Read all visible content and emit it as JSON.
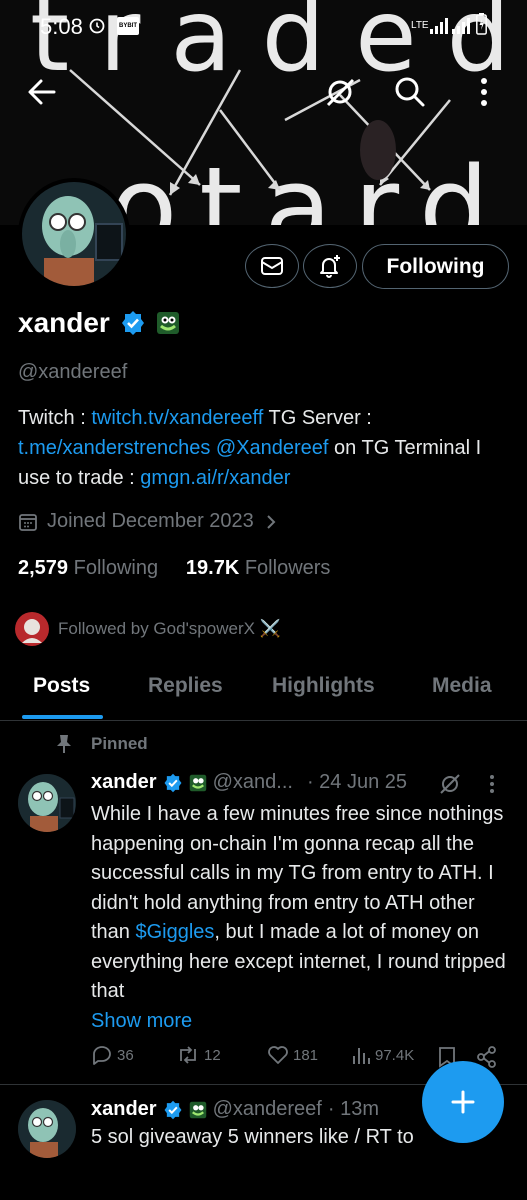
{
  "status_bar": {
    "time": "5:08",
    "network": "LTE",
    "app_badge": "BYBIT"
  },
  "header": {
    "back_icon": "arrow-left-icon",
    "grok_icon": "grok-icon",
    "search_icon": "search-icon",
    "more_icon": "more-vertical-icon"
  },
  "banner": {
    "top_text": "traded",
    "bottom_text": "otard"
  },
  "profile": {
    "name": "xander",
    "handle": "@xandereef",
    "follow_button": "Following",
    "bio": {
      "p1": "Twitch : ",
      "l1": "twitch.tv/xandereeff",
      "p2": "  TG Server : ",
      "l2": "t.me/xanderstrenches",
      "p3": " ",
      "l3": "@Xandereef",
      "p4": " on TG  Terminal I use to trade : ",
      "l4": "gmgn.ai/r/xander"
    },
    "joined": "Joined December 2023",
    "following_count": "2,579",
    "following_label": "Following",
    "followers_count": "19.7K",
    "followers_label": "Followers",
    "followed_by": "Followed by God'spowerX ⚔️"
  },
  "tabs": [
    "Posts",
    "Replies",
    "Highlights",
    "Media"
  ],
  "pinned_label": "Pinned",
  "posts": [
    {
      "name": "xander",
      "handle": "@xand...",
      "time": "· 24 Jun 25",
      "text_before": "While I have a few minutes free since nothings happening on-chain I'm gonna recap all the successful calls in my TG from entry to ATH. I didn't hold anything from entry to ATH other than ",
      "cashtag": "$Giggles",
      "text_after": ", but I made a lot of money on everything here except internet, I round tripped that",
      "show_more": "Show more",
      "replies": "36",
      "reposts": "12",
      "likes": "181",
      "views": "97.4K"
    },
    {
      "name": "xander",
      "handle": "@xandereef",
      "time": "· 13m",
      "text": "5 sol giveaway 5 winners like / RT to"
    }
  ],
  "colors": {
    "accent": "#1d9bf0",
    "muted": "#71767b",
    "border": "#2f3336",
    "bg": "#000000"
  }
}
